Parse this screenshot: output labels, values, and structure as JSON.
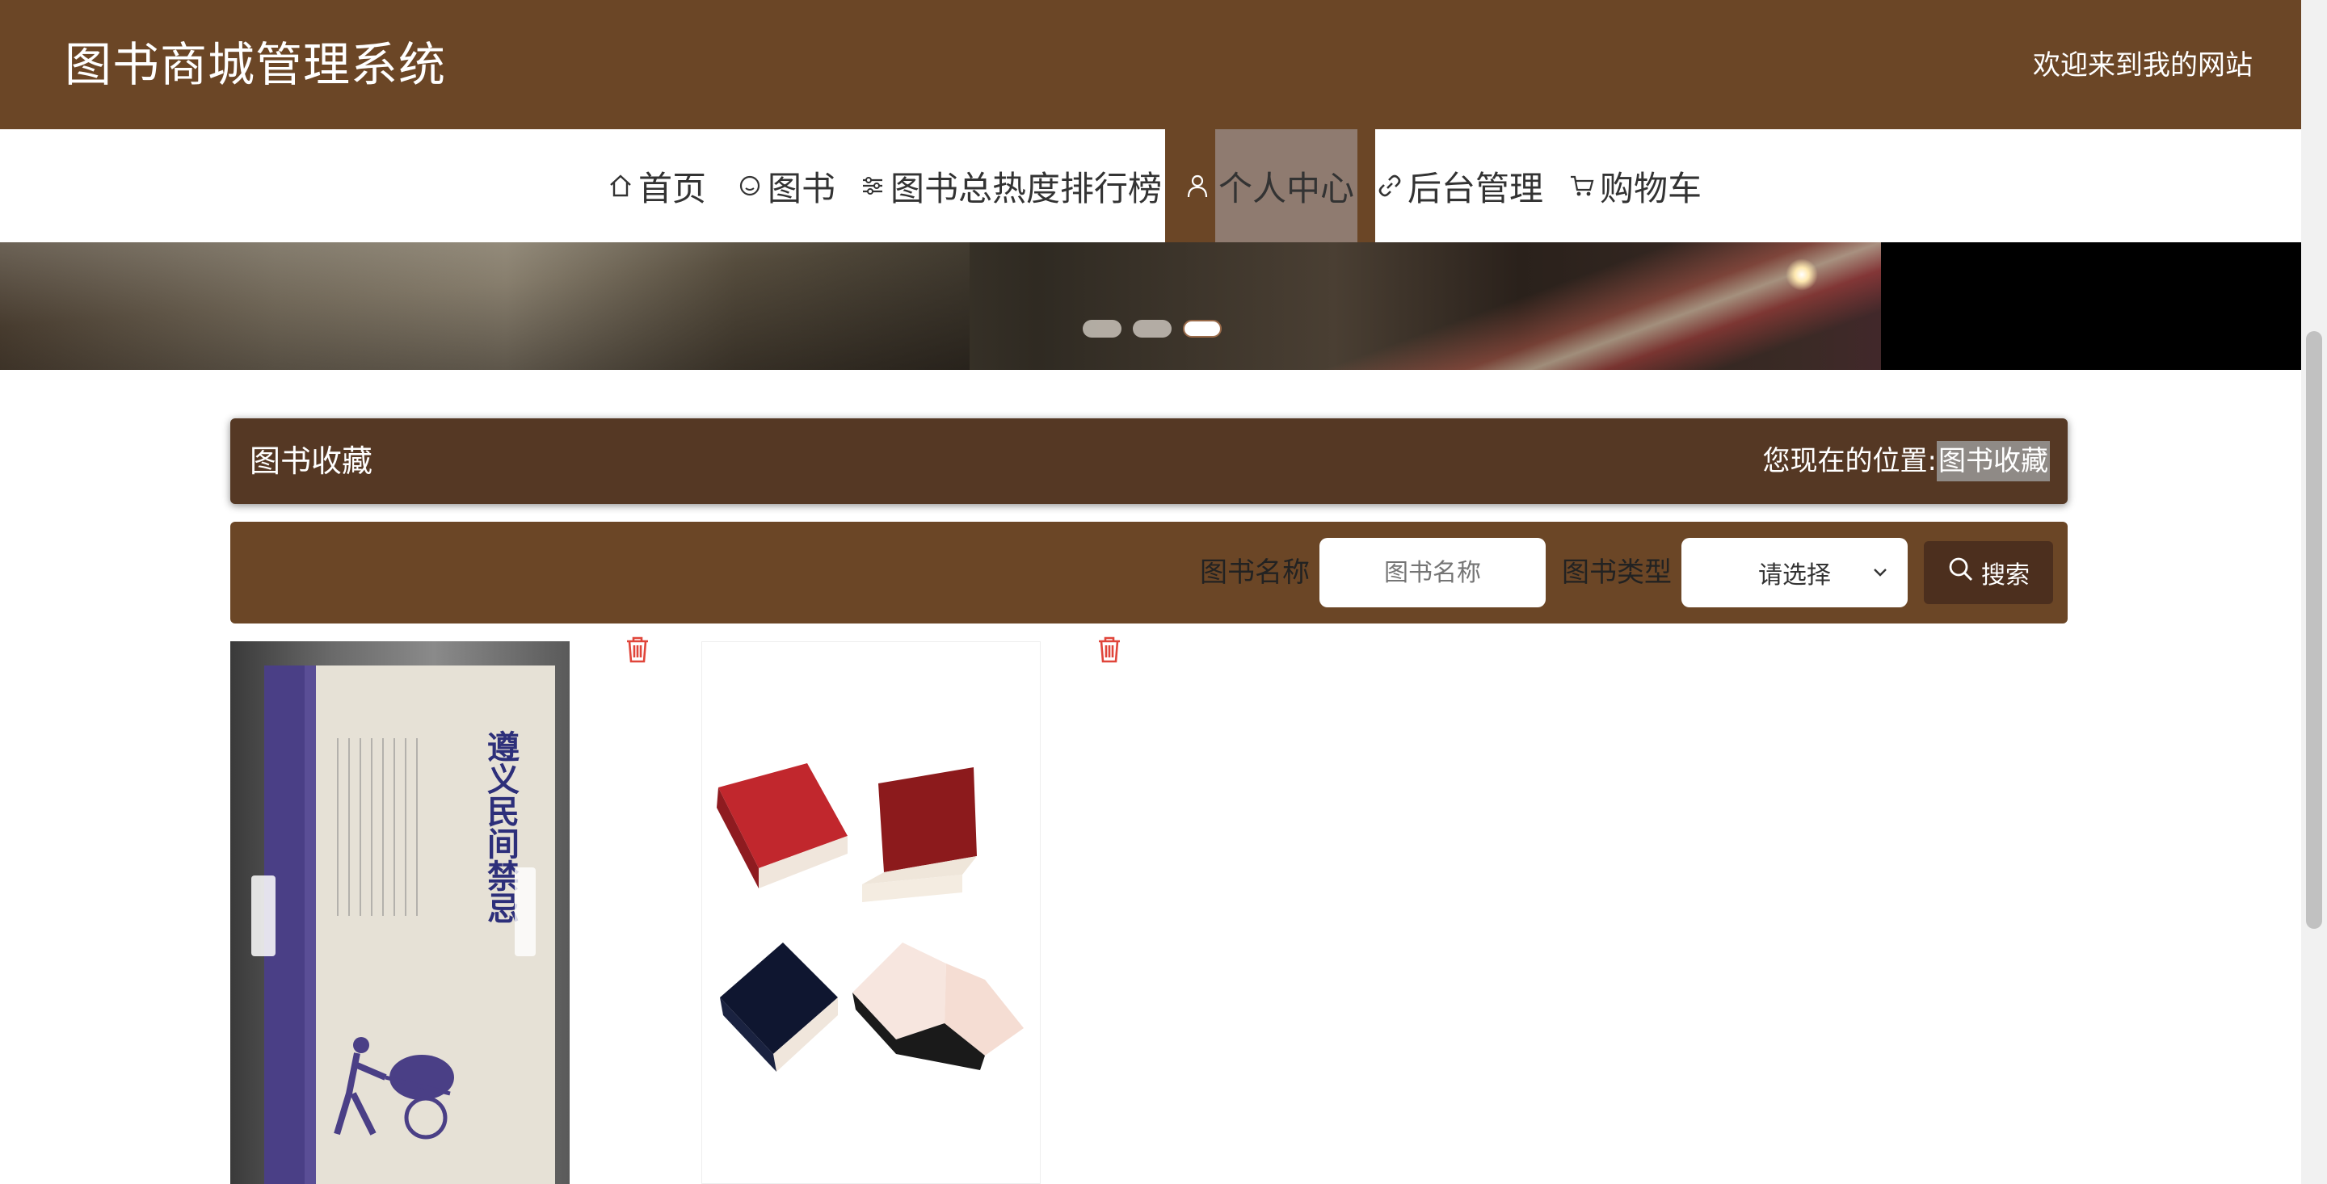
{
  "header": {
    "site_title": "图书商城管理系统",
    "welcome": "欢迎来到我的网站"
  },
  "nav": {
    "items": [
      {
        "label": "首页",
        "icon": "home-icon"
      },
      {
        "label": "图书",
        "icon": "circle-icon"
      },
      {
        "label": "图书总热度排行榜",
        "icon": "sliders-icon"
      },
      {
        "label": "个人中心",
        "icon": "user-icon"
      },
      {
        "label": "后台管理",
        "icon": "link-icon"
      },
      {
        "label": "购物车",
        "icon": "cart-icon"
      }
    ],
    "active_index": 3
  },
  "banner": {
    "slide_count": 3,
    "active_slide": 3
  },
  "page_title": {
    "title": "图书收藏",
    "location_label": "您现在的位置:",
    "location_current": "图书收藏"
  },
  "search": {
    "name_label": "图书名称",
    "name_placeholder": "图书名称",
    "type_label": "图书类型",
    "type_selected": "请选择",
    "button_label": "搜索"
  },
  "books": [
    {
      "cover_title": "遵义民间禁忌",
      "icon": "trash-icon"
    },
    {
      "cover_title": "",
      "icon": "trash-icon"
    }
  ],
  "colors": {
    "header_bg": "#6b4626",
    "title_box_bg": "#553824",
    "search_bg": "#6b4626",
    "button_bg": "#4c2f1e",
    "trash": "#e0453a"
  }
}
